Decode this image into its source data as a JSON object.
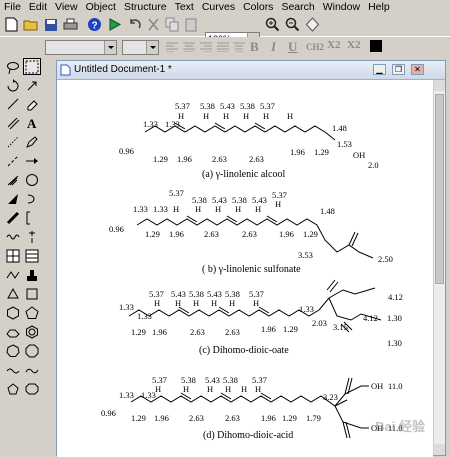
{
  "menu": [
    "File",
    "Edit",
    "View",
    "Object",
    "Structure",
    "Text",
    "Curves",
    "Colors",
    "Search",
    "Window",
    "Help"
  ],
  "toolbar": {
    "zoom": "100%"
  },
  "format": {
    "bold": "B",
    "italic": "I",
    "underline": "U",
    "ch2": "CH2",
    "sub": "X2",
    "sup": "X2"
  },
  "document": {
    "title": "Untitled Document-1 *"
  },
  "molecules": [
    {
      "caption": "(a) γ-linolenic alcool",
      "top_labels": [
        "5.37",
        "5.38",
        "5.43",
        "5.38",
        "5.37"
      ],
      "h_labels": [
        "H",
        "H",
        "H",
        "H",
        "H",
        "H"
      ],
      "side_labels": [
        "1.33",
        "1.33",
        "1.48",
        "0.96",
        "1.29",
        "1.96",
        "2.63",
        "2.63",
        "1.96",
        "1.29",
        "1.53",
        "OH",
        "2.0"
      ]
    },
    {
      "caption": "( b) γ-linolenic sulfonate",
      "top_labels": [
        "5.37",
        "5.38",
        "5.43",
        "5.38",
        "5.43",
        "5.37"
      ],
      "h_labels": [
        "H",
        "H",
        "H",
        "H",
        "H",
        "H"
      ],
      "side_labels": [
        "1.33",
        "1.33",
        "1.48",
        "0.96",
        "1.29",
        "1.96",
        "2.63",
        "2.63",
        "1.96",
        "1.29",
        "3.53",
        "2.50"
      ]
    },
    {
      "caption": "(c) Dihomo-dioic-oate",
      "top_labels": [
        "5.37",
        "5.43",
        "5.38",
        "5.43",
        "5.38",
        "5.37"
      ],
      "h_labels": [
        "H",
        "H",
        "H",
        "H",
        "H",
        "H"
      ],
      "side_labels": [
        "1.33",
        "1.33",
        "1.33",
        "1.29",
        "1.96",
        "2.63",
        "2.63",
        "1.96",
        "1.29",
        "2.03",
        "3.15",
        "4.12",
        "4.12",
        "1.30",
        "1.30"
      ]
    },
    {
      "caption": "(d) Dihomo-dioic-acid",
      "top_labels": [
        "5.37",
        "5.38",
        "5.43",
        "5.38",
        "5.37"
      ],
      "h_labels": [
        "H",
        "H",
        "H",
        "H",
        "H",
        "H"
      ],
      "side_labels": [
        "1.33",
        "1.33",
        "0.96",
        "1.29",
        "1.96",
        "2.63",
        "2.63",
        "1.96",
        "1.29",
        "1.79",
        "3.23",
        "OH",
        "11.0",
        "OH",
        "11.0"
      ]
    }
  ],
  "watermark": "Bai 经验"
}
